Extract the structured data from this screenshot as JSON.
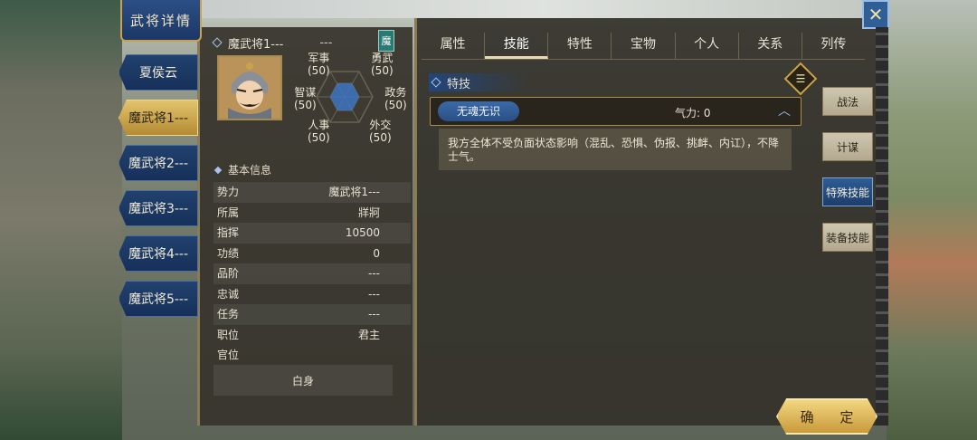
{
  "window": {
    "title": "武将详情",
    "close_icon": "close-icon"
  },
  "generals": [
    {
      "label": "夏侯云",
      "active": false
    },
    {
      "label": "魔武将1---",
      "active": true
    },
    {
      "label": "魔武将2---",
      "active": false
    },
    {
      "label": "魔武将3---",
      "active": false
    },
    {
      "label": "魔武将4---",
      "active": false
    },
    {
      "label": "魔武将5---",
      "active": false
    }
  ],
  "profile": {
    "name": "魔武将1---",
    "suffix": "---",
    "faction_badge": "魔"
  },
  "stats": {
    "military": {
      "label": "军事",
      "value": "(50)"
    },
    "valor": {
      "label": "勇武",
      "value": "(50)"
    },
    "strategy": {
      "label": "智谋",
      "value": "(50)"
    },
    "politics": {
      "label": "政务",
      "value": "(50)"
    },
    "personnel": {
      "label": "人事",
      "value": "(50)"
    },
    "diplomacy": {
      "label": "外交",
      "value": "(50)"
    }
  },
  "basic_info": {
    "heading": "基本信息",
    "rows": [
      {
        "key": "势力",
        "value": "魔武将1---"
      },
      {
        "key": "所属",
        "value": "牂牁"
      },
      {
        "key": "指挥",
        "value": "10500"
      },
      {
        "key": "功绩",
        "value": "0"
      },
      {
        "key": "品阶",
        "value": "---"
      },
      {
        "key": "忠诚",
        "value": "---"
      },
      {
        "key": "任务",
        "value": "---"
      },
      {
        "key": "职位",
        "value": "君主"
      },
      {
        "key": "官位",
        "value": ""
      }
    ],
    "rank": "白身"
  },
  "tabs": [
    {
      "label": "属性",
      "active": false
    },
    {
      "label": "技能",
      "active": true
    },
    {
      "label": "特性",
      "active": false
    },
    {
      "label": "宝物",
      "active": false
    },
    {
      "label": "个人",
      "active": false
    },
    {
      "label": "关系",
      "active": false
    },
    {
      "label": "列传",
      "active": false
    }
  ],
  "skill_section": {
    "heading": "特技",
    "skill_name": "无魂无识",
    "qi_text": "气力: 0",
    "description": "我方全体不受负面状态影响（混乱、恐惧、伪报、挑衅、内讧），不降士气。"
  },
  "side_tabs": [
    {
      "label": "战法",
      "active": false
    },
    {
      "label": "计谋",
      "active": false
    },
    {
      "label": "特殊技能",
      "active": true
    },
    {
      "label": "装备技能",
      "active": false
    }
  ],
  "confirm_label": "确 定",
  "colors": {
    "accent_gold": "#c9a24c",
    "accent_blue": "#2e5d95"
  }
}
